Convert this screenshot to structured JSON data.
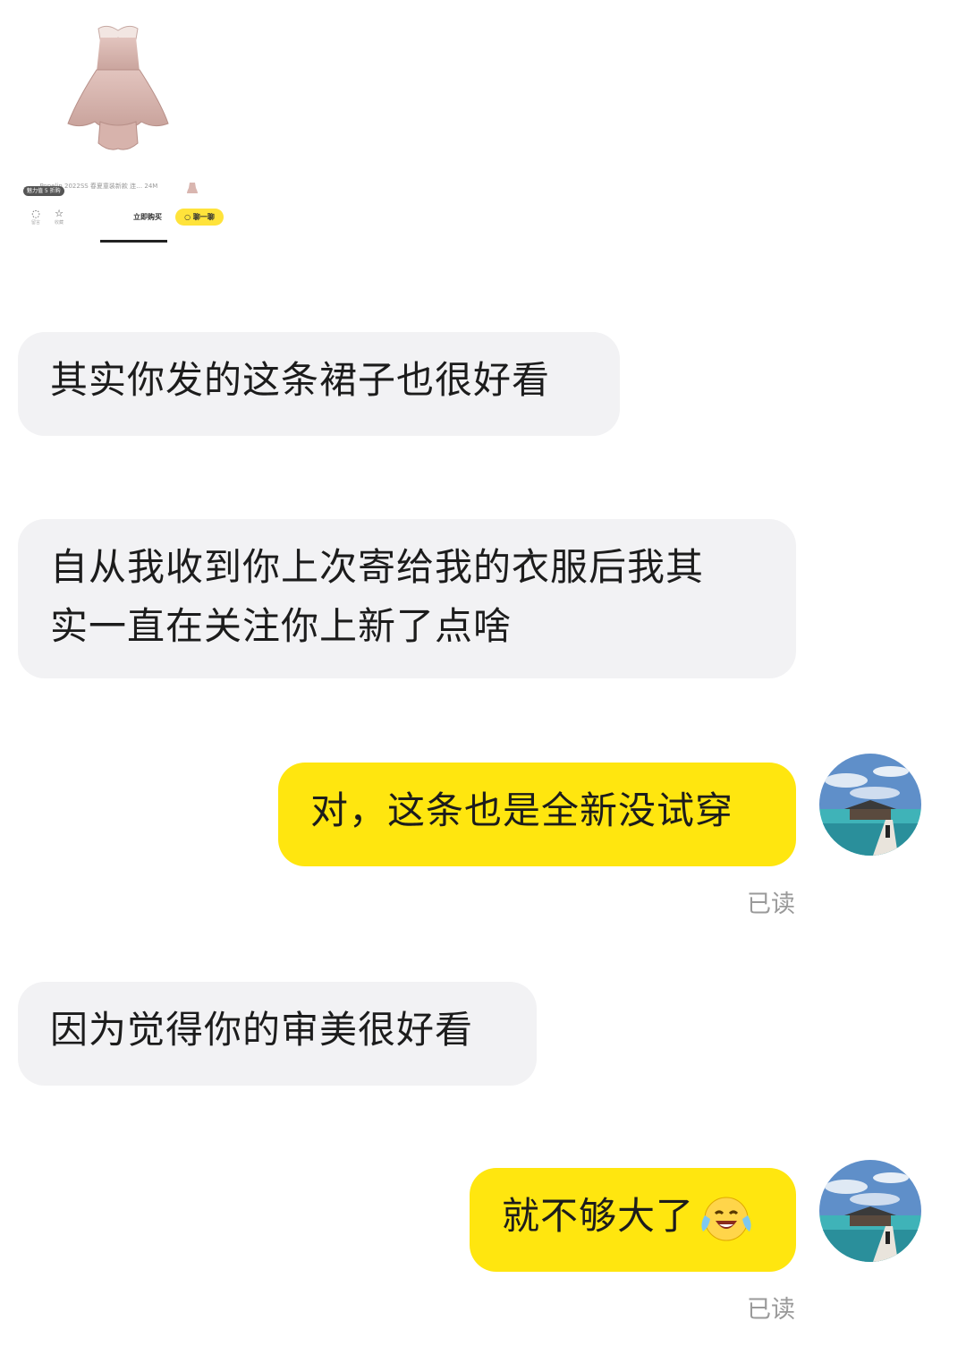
{
  "product_card": {
    "desc_text": "… … Popelin 2022SS 春夏童装新款 连… 24M",
    "badge": "魅力值 5 折购",
    "actions": [
      {
        "icon": "comment-icon",
        "label": "留言"
      },
      {
        "icon": "star-icon",
        "label": "收藏"
      }
    ],
    "buy_label": "立即购买",
    "chat_label": "聊一聊",
    "dress_color": "#d9b6b0"
  },
  "messages": [
    {
      "side": "in",
      "text": "其实你发的这条裙子也很好看"
    },
    {
      "side": "in",
      "lines": [
        "自从我收到你上次寄给我的衣服后我其",
        "实一直在关注你上新了点啥"
      ]
    },
    {
      "side": "out",
      "text": "对，这条也是全新没试穿",
      "status": "已读"
    },
    {
      "side": "in",
      "text": "因为觉得你的审美很好看"
    },
    {
      "side": "out",
      "text": "就不够大了",
      "emoji": "crying-laughing-emoji",
      "status": "已读"
    }
  ],
  "colors": {
    "incoming_bubble": "#f2f2f4",
    "outgoing_bubble": "#ffe60f",
    "chat_button": "#ffe33b"
  }
}
